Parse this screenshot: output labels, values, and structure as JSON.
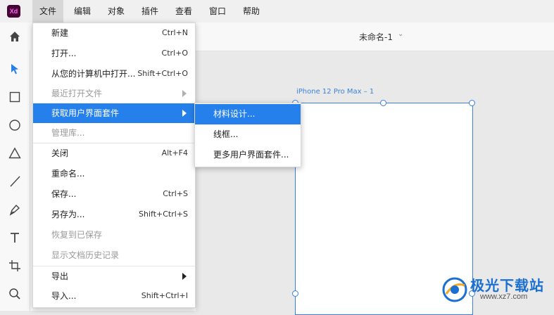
{
  "app": {
    "icon_text": "Xd"
  },
  "menubar": {
    "items": [
      "文件",
      "编辑",
      "对象",
      "插件",
      "查看",
      "窗口",
      "帮助"
    ]
  },
  "document": {
    "title": "未命名-1"
  },
  "canvas": {
    "artboard_label": "iPhone 12 Pro Max – 1"
  },
  "file_menu": {
    "items": [
      {
        "label": "新建",
        "shortcut": "Ctrl+N"
      },
      {
        "label": "打开...",
        "shortcut": "Ctrl+O"
      },
      {
        "label": "从您的计算机中打开...",
        "shortcut": "Shift+Ctrl+O"
      },
      {
        "label": "最近打开文件",
        "shortcut": ""
      },
      {
        "label": "获取用户界面套件",
        "shortcut": ""
      },
      {
        "label": "管理库...",
        "shortcut": ""
      },
      {
        "label": "关闭",
        "shortcut": "Alt+F4"
      },
      {
        "label": "重命名...",
        "shortcut": ""
      },
      {
        "label": "保存...",
        "shortcut": "Ctrl+S"
      },
      {
        "label": "另存为...",
        "shortcut": "Shift+Ctrl+S"
      },
      {
        "label": "恢复到已保存",
        "shortcut": ""
      },
      {
        "label": "显示文档历史记录",
        "shortcut": ""
      },
      {
        "label": "导出",
        "shortcut": ""
      },
      {
        "label": "导入...",
        "shortcut": "Shift+Ctrl+I"
      }
    ]
  },
  "ui_kits_submenu": {
    "items": [
      "材料设计...",
      "线框...",
      "更多用户界面套件..."
    ]
  },
  "watermark": {
    "title": "极光下载站",
    "url": "www.xz7.com"
  },
  "colors": {
    "accent": "#2680eb",
    "artboard_border": "#3a7fe0"
  }
}
